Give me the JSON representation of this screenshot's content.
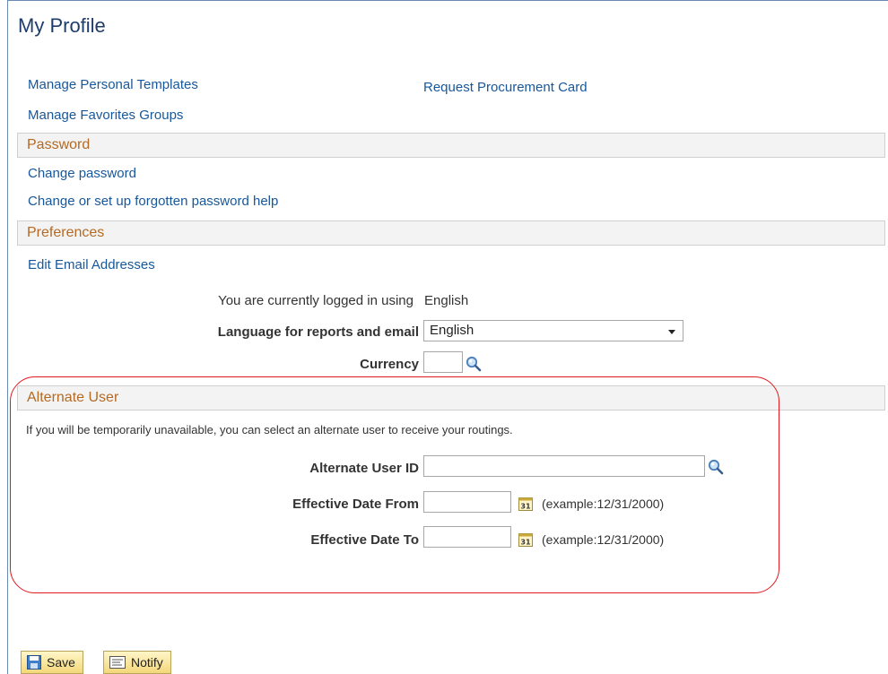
{
  "page": {
    "title": "My Profile"
  },
  "links": {
    "manage_templates": "Manage Personal Templates",
    "request_card": "Request Procurement Card",
    "manage_favorites": "Manage Favorites Groups"
  },
  "password": {
    "header": "Password",
    "change_password": "Change password",
    "forgotten_help": "Change or set up forgotten password help"
  },
  "preferences": {
    "header": "Preferences",
    "edit_email": "Edit Email Addresses",
    "logged_in_label": "You are currently logged in using",
    "logged_in_value": "English",
    "language_label": "Language for reports and email",
    "language_value": "English",
    "currency_label": "Currency",
    "currency_value": ""
  },
  "alternate_user": {
    "header": "Alternate User",
    "note": "If you will be temporarily unavailable, you can select an alternate user to receive your routings.",
    "user_id_label": "Alternate User ID",
    "user_id_value": "",
    "date_from_label": "Effective Date From",
    "date_from_value": "",
    "date_to_label": "Effective Date To",
    "date_to_value": "",
    "date_example": "(example:12/31/2000)",
    "calendar_icon_text": "31"
  },
  "buttons": {
    "save": "Save",
    "notify": "Notify"
  },
  "colors": {
    "title": "#1f3d6b",
    "link": "#17579b",
    "section_header": "#b36a24",
    "highlight": "#e0191f"
  }
}
